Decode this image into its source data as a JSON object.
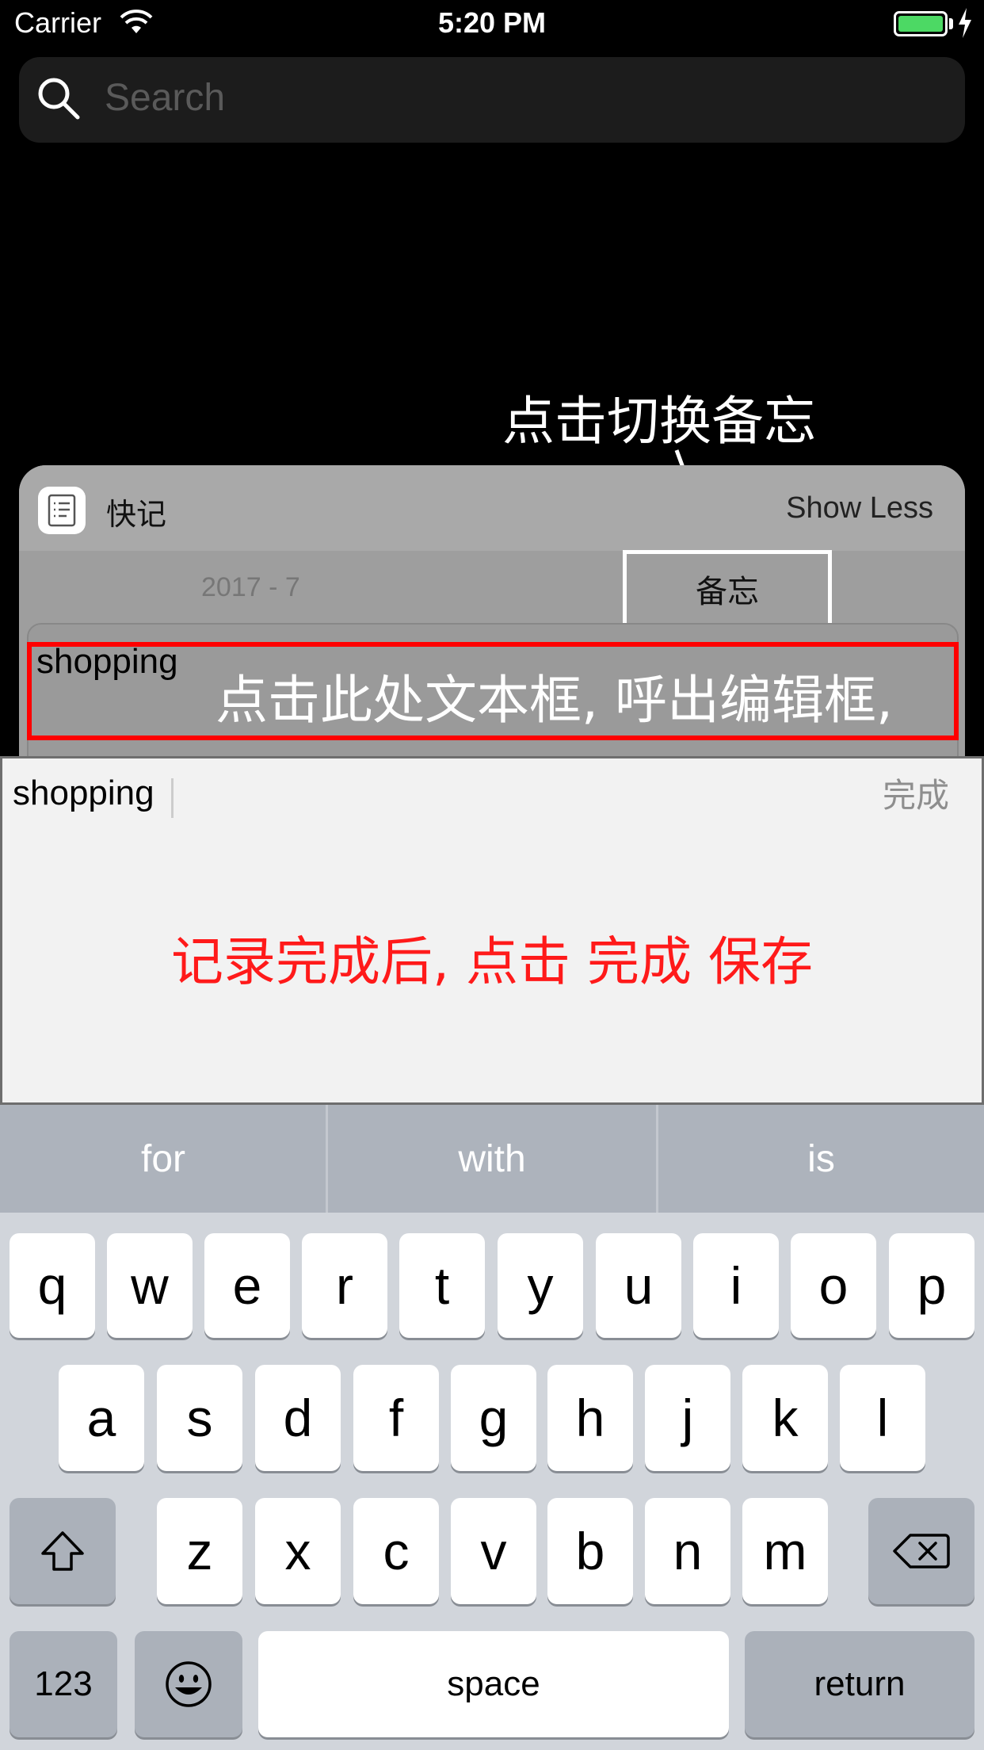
{
  "status": {
    "carrier": "Carrier",
    "time": "5:20 PM"
  },
  "search": {
    "placeholder": "Search"
  },
  "annotations": {
    "switch_memo": "点击切换备忘",
    "tap_textbox": "点击此处文本框, 呼出编辑框,",
    "save_hint": "记录完成后, 点击 完成 保存"
  },
  "widget": {
    "app_name": "快记",
    "show_less": "Show Less",
    "date": "2017 - 7",
    "memo_tab": "备忘",
    "note_text": "shopping"
  },
  "editor": {
    "text": "shopping",
    "done": "完成"
  },
  "keyboard": {
    "predictions": [
      "for",
      "with",
      "is"
    ],
    "row1": [
      "q",
      "w",
      "e",
      "r",
      "t",
      "y",
      "u",
      "i",
      "o",
      "p"
    ],
    "row2": [
      "a",
      "s",
      "d",
      "f",
      "g",
      "h",
      "j",
      "k",
      "l"
    ],
    "row3": [
      "z",
      "x",
      "c",
      "v",
      "b",
      "n",
      "m"
    ],
    "numbers": "123",
    "space": "space",
    "return": "return"
  },
  "colors": {
    "annotation_red": "#ff0000",
    "battery_green": "#4cd964"
  }
}
